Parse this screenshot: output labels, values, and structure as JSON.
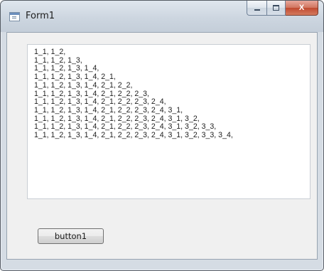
{
  "window": {
    "title": "Form1"
  },
  "caption": {
    "minimize_icon": "minimize-icon",
    "maximize_icon": "maximize-icon",
    "close_icon": "close-icon",
    "close_glyph": "X"
  },
  "textbox": {
    "lines": [
      "1_1, 1_2,",
      "1_1, 1_2, 1_3,",
      "1_1, 1_2, 1_3, 1_4,",
      "1_1, 1_2, 1_3, 1_4, 2_1,",
      "1_1, 1_2, 1_3, 1_4, 2_1, 2_2,",
      "1_1, 1_2, 1_3, 1_4, 2_1, 2_2, 2_3,",
      "1_1, 1_2, 1_3, 1_4, 2_1, 2_2, 2_3, 2_4,",
      "1_1, 1_2, 1_3, 1_4, 2_1, 2_2, 2_3, 2_4, 3_1,",
      "1_1, 1_2, 1_3, 1_4, 2_1, 2_2, 2_3, 2_4, 3_1, 3_2,",
      "1_1, 1_2, 1_3, 1_4, 2_1, 2_2, 2_3, 2_4, 3_1, 3_2, 3_3,",
      "1_1, 1_2, 1_3, 1_4, 2_1, 2_2, 2_3, 2_4, 3_1, 3_2, 3_3, 3_4,"
    ]
  },
  "button1": {
    "label": "button1"
  },
  "colors": {
    "close_button": "#c04a30",
    "frame": "#d5dce4",
    "client_background": "#f0f0f0"
  }
}
